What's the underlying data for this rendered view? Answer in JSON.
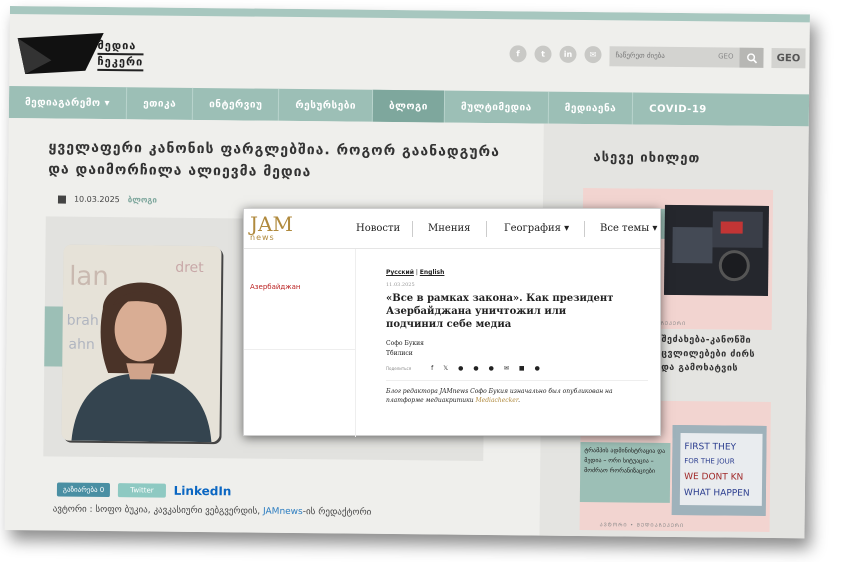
{
  "header": {
    "logo_line1": "მედია",
    "logo_line2": "ჩეკერი",
    "socials": [
      {
        "icon": "facebook-icon",
        "glyph": "f"
      },
      {
        "icon": "twitter-icon",
        "glyph": "t"
      },
      {
        "icon": "linkedin-icon",
        "glyph": "in"
      },
      {
        "icon": "mail-icon",
        "glyph": "✉"
      }
    ],
    "search_placeholder": "ჩაწერეთ ძიება",
    "search_lang_hint": "GEO",
    "lang_button": "GEO"
  },
  "nav": {
    "items": [
      {
        "label": "მედიაგარემო ▾",
        "active": false
      },
      {
        "label": "ეთიკა",
        "active": false
      },
      {
        "label": "ინტერვიუ",
        "active": false
      },
      {
        "label": "რესურსები",
        "active": false
      },
      {
        "label": "ბლოგი",
        "active": true
      },
      {
        "label": "მულტიმედია",
        "active": false
      },
      {
        "label": "მედიაენა",
        "active": false
      },
      {
        "label": "COVID-19",
        "active": false
      }
    ]
  },
  "article": {
    "title": "ყველაფერი კანონის ფარგლებშია. როგორ გაანადგურა და დაიმორჩილა ალიევმა მედია",
    "date": "10.03.2025",
    "category": "ბლოგი",
    "share_facebook": "გაზიარება 0",
    "share_twitter": "Twitter",
    "share_linkedin": "LinkedIn",
    "author_prefix": "ავტორი : სოფო ბუკია, კავკასიური ვებგვერდის, ",
    "author_link": "JAMnews",
    "author_suffix": "-ის რედაქტორი"
  },
  "sidebar": {
    "title": "ასევე იხილეთ",
    "card1_text_1": "შეძახება-კანონში",
    "card1_text_2": "ცვლილებები ძირს",
    "card1_text_3": "და გამოხატვის",
    "card1_footer": "ᲐᲕᲢᲝᲠᲘ • ᲛᲔᲓᲘᲐᲩᲔᲙᲔᲠᲘ",
    "card2_text": "ტრამპის ადმინისტრაცია და მედია – ორი სიტუაცია – მოძრაო რორანიზაციები",
    "card2_footer": "ᲐᲕᲢᲝᲠᲘ • ᲛᲔᲓᲘᲐᲩᲔᲙᲔᲠᲘ",
    "card2_sign_1": "FIRST THEY",
    "card2_sign_2": "FOR THE JOUR",
    "card2_sign_3": "WE DONT KN",
    "card2_sign_4": "WHAT HAPPEN"
  },
  "photo_wall": {
    "w1": "lan",
    "w2": "brah",
    "w3": "ahn",
    "w4": "dret"
  },
  "jamnews": {
    "logo": "JAM",
    "logo_sub": "news",
    "nav_news": "Новости",
    "nav_opinions": "Мнения",
    "nav_geo": "География",
    "nav_all": "Все темы",
    "side_tag": "Азербайджан",
    "crumb_lang1": "Русский",
    "crumb_sep": "|",
    "crumb_lang2": "English",
    "date": "11.03.2025",
    "headline": "«Все в рамках закона». Как президент Азербайджана уничтожил или подчинил себе медиа",
    "author": "Софо Букия",
    "city": "Тбилиси",
    "share_label": "Поделиться",
    "intro_text": "Блог редактора JAMnews Софо Букия изначально был опубликован на платформе медиакритики ",
    "intro_link": "Mediachecker",
    "intro_end": "."
  }
}
